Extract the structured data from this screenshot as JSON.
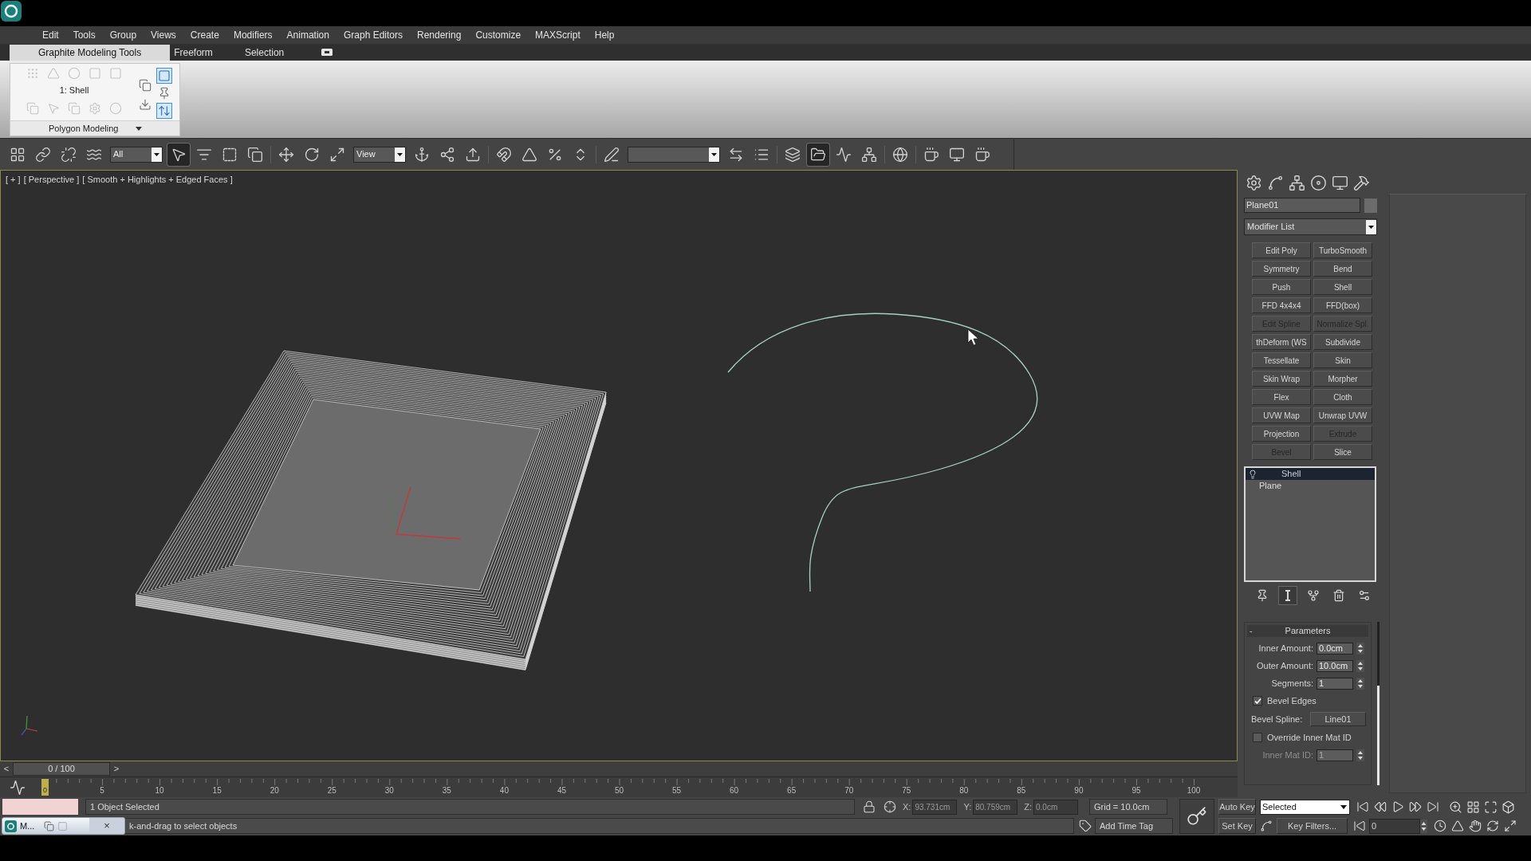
{
  "menu_bar": {
    "items": [
      "Edit",
      "Tools",
      "Group",
      "Views",
      "Create",
      "Modifiers",
      "Animation",
      "Graph Editors",
      "Rendering",
      "Customize",
      "MAXScript",
      "Help"
    ]
  },
  "ribbon": {
    "tabs": [
      {
        "label": "Graphite Modeling Tools",
        "selected": true
      },
      {
        "label": "Freeform",
        "selected": false
      },
      {
        "label": "Selection",
        "selected": false
      }
    ],
    "stack_level": "1: Shell",
    "panel_title": "Polygon Modeling",
    "quick_buttons": [
      {
        "selected": false
      },
      {
        "selected": false
      },
      {
        "selected": true
      },
      {
        "selected": false
      },
      {
        "selected": true
      }
    ]
  },
  "main_toolbar": {
    "selection_filter": "All",
    "reference_coordinate_system": "View",
    "buttons": [
      {
        "selected": false
      },
      {
        "selected": false
      },
      {
        "selected": false
      },
      {
        "selected": false
      },
      {
        "selected": true
      },
      {
        "selected": false
      },
      {
        "selected": false
      },
      {
        "selected": false
      },
      {
        "selected": false
      },
      {
        "selected": false
      },
      {
        "selected": false
      },
      {
        "selected": false
      },
      {
        "selected": false
      },
      {
        "selected": false
      },
      {
        "selected": false
      },
      {
        "selected": false
      },
      {
        "selected": false
      },
      {
        "selected": false
      },
      {
        "selected": false
      },
      {
        "selected": false
      },
      {
        "selected": false
      },
      {
        "selected": false
      },
      {
        "selected": true
      },
      {
        "selected": false
      },
      {
        "selected": false
      },
      {
        "selected": false
      },
      {
        "selected": false
      },
      {
        "selected": false
      },
      {
        "selected": false
      }
    ]
  },
  "viewport": {
    "labels": [
      "[ + ]",
      "[ Perspective ]",
      "[ Smooth + Highlights + Edged Faces ]"
    ]
  },
  "time_slider": {
    "previous": "<",
    "label": "0 / 100",
    "next": ">",
    "level": 0
  },
  "track_bar": {
    "current_frame": "0",
    "labels": [
      "5",
      "10",
      "15",
      "20",
      "25",
      "30",
      "35",
      "40",
      "45",
      "50",
      "55",
      "60",
      "65",
      "70",
      "75",
      "80",
      "85",
      "90",
      "95",
      "100"
    ]
  },
  "command_panel": {
    "object_name": "Plane01",
    "modifier_list": "Modifier List",
    "modifier_buttons": [
      {
        "label": "Edit Poly",
        "disabled": false
      },
      {
        "label": "TurboSmooth",
        "disabled": false
      },
      {
        "label": "Symmetry",
        "disabled": false
      },
      {
        "label": "Bend",
        "disabled": false
      },
      {
        "label": "Push",
        "disabled": false
      },
      {
        "label": "Shell",
        "disabled": false
      },
      {
        "label": "FFD 4x4x4",
        "disabled": false
      },
      {
        "label": "FFD(box)",
        "disabled": false
      },
      {
        "label": "Edit Spline",
        "disabled": true
      },
      {
        "label": "Normalize Spl.",
        "disabled": true
      },
      {
        "label": "thDeform (WS",
        "disabled": false
      },
      {
        "label": "Subdivide",
        "disabled": false
      },
      {
        "label": "Tessellate",
        "disabled": false
      },
      {
        "label": "Skin",
        "disabled": false
      },
      {
        "label": "Skin Wrap",
        "disabled": false
      },
      {
        "label": "Morpher",
        "disabled": false
      },
      {
        "label": "Flex",
        "disabled": false
      },
      {
        "label": "Cloth",
        "disabled": false
      },
      {
        "label": "UVW Map",
        "disabled": false
      },
      {
        "label": "Unwrap UVW",
        "disabled": false
      },
      {
        "label": "Projection",
        "disabled": false
      },
      {
        "label": "Extrude",
        "disabled": true
      },
      {
        "label": "Bevel",
        "disabled": true
      },
      {
        "label": "Slice",
        "disabled": false
      }
    ],
    "stack": [
      {
        "kind": "modifier",
        "label": "Shell",
        "selected": true
      },
      {
        "kind": "base_object",
        "label": "Plane",
        "selected": false
      }
    ],
    "stack_toolbar": [
      {
        "selected": false
      },
      {
        "selected": true
      },
      {
        "selected": false
      },
      {
        "selected": false
      },
      {
        "selected": false
      }
    ],
    "parameters": {
      "collapse": "-",
      "title": "Parameters",
      "controls": [
        {
          "kind": "spinner",
          "label": "Inner Amount:",
          "value": "0.0cm",
          "disabled": false
        },
        {
          "kind": "spinner",
          "label": "Outer Amount:",
          "value": "10.0cm",
          "disabled": false
        },
        {
          "kind": "spinner",
          "label": "Segments:",
          "value": "1",
          "disabled": false
        },
        {
          "kind": "checkbox",
          "label": "Bevel Edges",
          "checked": true,
          "disabled": false
        },
        {
          "kind": "picker",
          "label": "Bevel Spline:",
          "value": "Line01",
          "disabled": false
        },
        {
          "kind": "checkbox",
          "label": "Override Inner Mat ID",
          "checked": false,
          "disabled": false
        },
        {
          "kind": "spinner",
          "label": "Inner Mat ID:",
          "value": "1",
          "disabled": true
        }
      ]
    }
  },
  "status_bar": {
    "selection_info": "1 Object Selected",
    "coordinates": [
      {
        "axis": "X:",
        "value": "93.731cm"
      },
      {
        "axis": "Y:",
        "value": "80.759cm"
      },
      {
        "axis": "Z:",
        "value": "0.0cm"
      }
    ],
    "grid": "Grid = 10.0cm",
    "taskbar_item": {
      "label": "M...",
      "close": "×"
    },
    "prompt": "k-and-drag to select objects",
    "add_time_tag": "Add Time Tag"
  },
  "animation_controls": {
    "auto_key": "Auto Key",
    "key_mode": "Selected",
    "set_key": "Set Key",
    "key_filters": "Key Filters...",
    "current_frame": "0"
  }
}
